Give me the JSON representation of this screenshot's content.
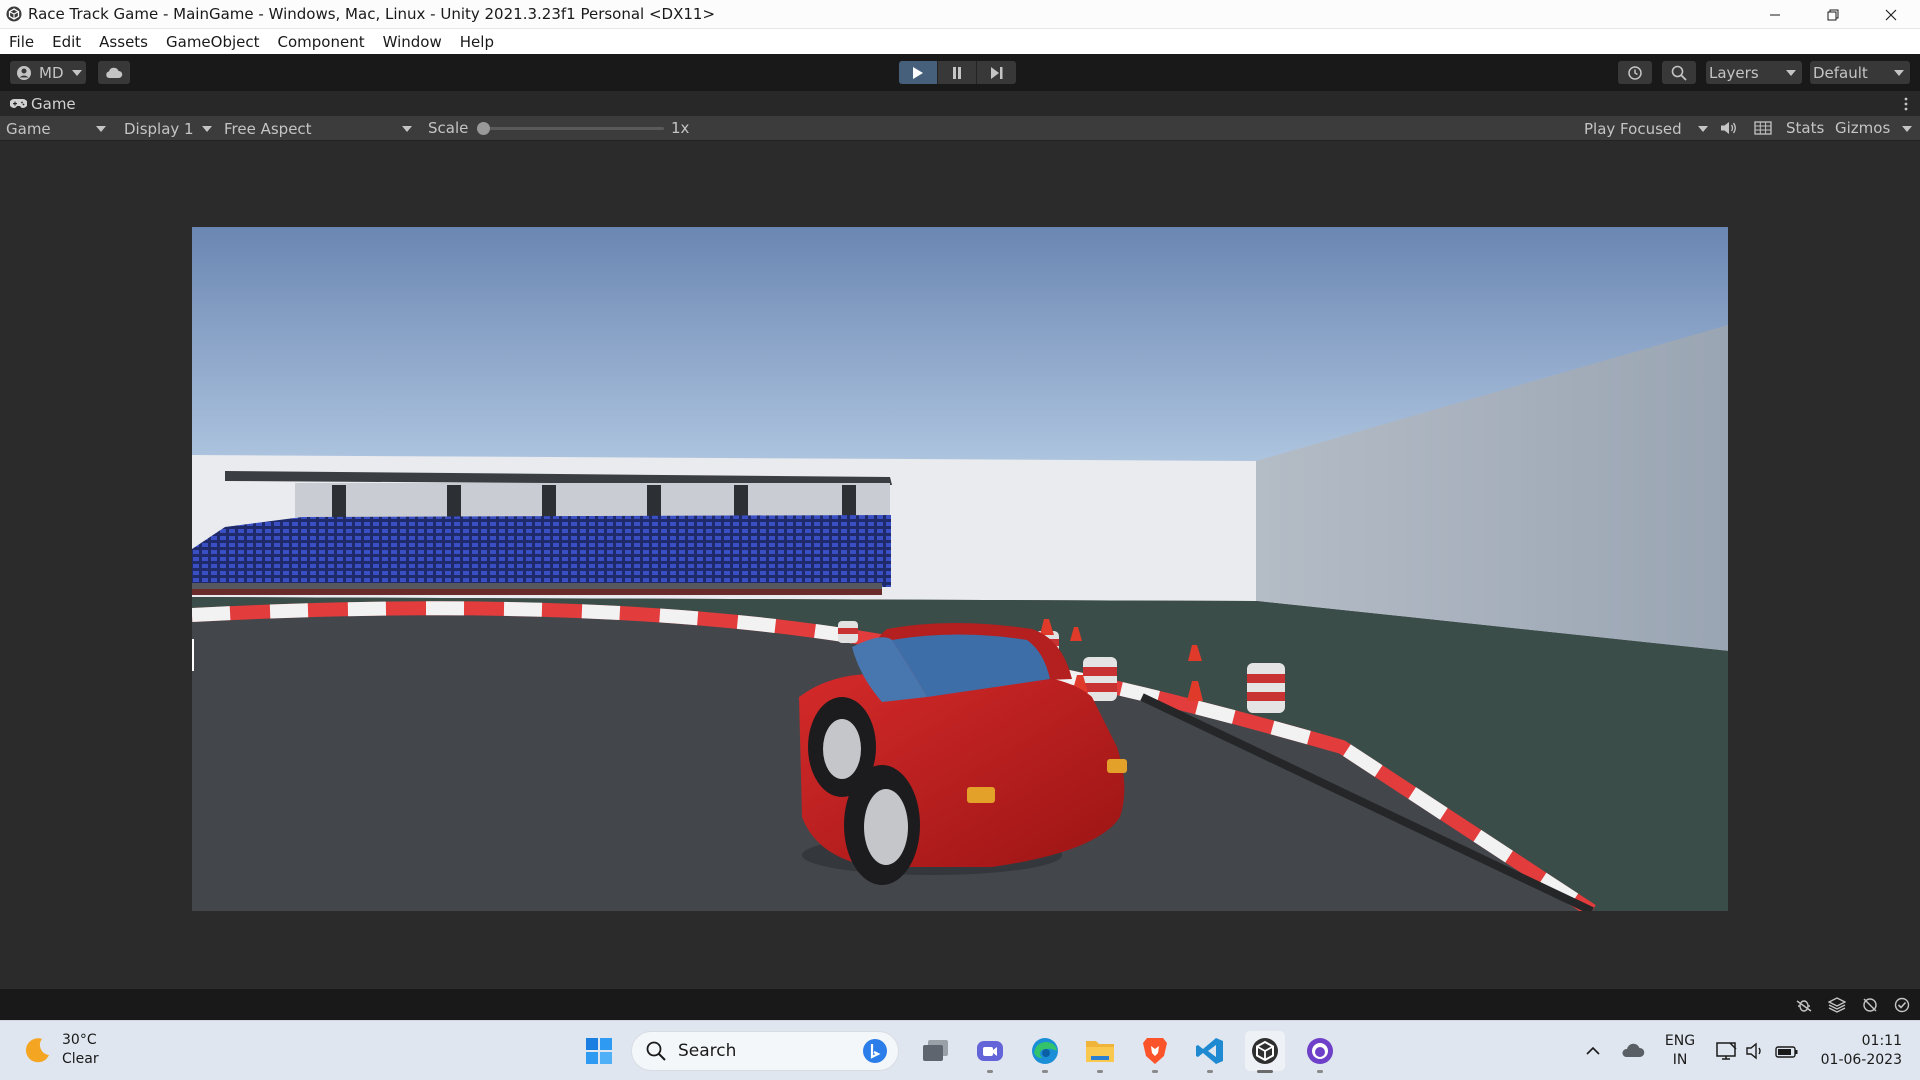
{
  "window": {
    "title": "Race Track Game - MainGame - Windows, Mac, Linux - Unity 2021.3.23f1 Personal <DX11>",
    "app_icon": "unity-icon",
    "controls": [
      "minimize-icon",
      "restore-icon",
      "close-icon"
    ]
  },
  "menu": {
    "items": [
      "File",
      "Edit",
      "Assets",
      "GameObject",
      "Component",
      "Window",
      "Help"
    ]
  },
  "toolbar": {
    "account_label": "MD",
    "cloud_icon": "cloud-icon",
    "play_icon": "play-icon",
    "pause_icon": "pause-icon",
    "step_icon": "step-icon",
    "play_active_color": "#46607c",
    "history_icon": "history-icon",
    "search_icon": "search-icon",
    "layers_label": "Layers",
    "layout_label": "Default"
  },
  "tab": {
    "label": "Game",
    "icon": "gamepad-icon"
  },
  "game_view": {
    "view_dropdown": "Game",
    "display_dropdown": "Display 1",
    "aspect_dropdown": "Free Aspect",
    "scale_label": "Scale",
    "scale_value": "1x",
    "play_mode": "Play Focused",
    "audio_icon": "speaker-icon",
    "grid_icon": "grid-icon",
    "stats_label": "Stats",
    "gizmos_label": "Gizmos"
  },
  "status_icons": [
    "debug-icon",
    "layers-icon",
    "no-auto-generate-icon",
    "check-icon"
  ],
  "taskbar": {
    "weather": {
      "temp": "30°C",
      "condition": "Clear",
      "icon": "moon-icon"
    },
    "search_label": "Search",
    "apps": [
      "windows-start-icon",
      "search-icon",
      "task-view-icon",
      "teams-icon",
      "edge-icon",
      "file-explorer-icon",
      "brave-icon",
      "vscode-icon",
      "unity-icon",
      "github-desktop-icon"
    ],
    "tray": {
      "lang_top": "ENG",
      "lang_bottom": "IN",
      "time": "01:11",
      "date": "01-06-2023"
    }
  }
}
